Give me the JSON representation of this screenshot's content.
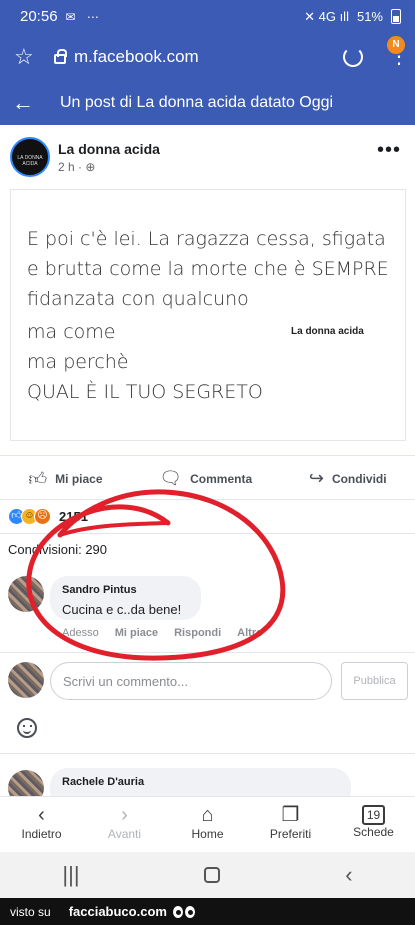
{
  "status": {
    "time": "20:56",
    "left_icons": "✉ ⋯",
    "right_icons": "✕ 4G ıll",
    "battery": "51%"
  },
  "browser": {
    "url": "m.facebook.com",
    "notification_badge": "N"
  },
  "header": {
    "title": "Un post di La donna acida datato Oggi"
  },
  "post": {
    "author": "La donna acida",
    "avatar_text": "LA DONNA ACIDA",
    "meta": "2 h · ⊕",
    "image_lines": [
      "E poi c'è lei. La ragazza cessa, sfigata",
      "e brutta come la morte che è SEMPRE",
      "fidanzata con qualcuno",
      "ma come",
      "ma perchè",
      "QUAL È IL TUO SEGRETO"
    ],
    "image_watermark": "La donna acida",
    "actions": {
      "like": "Mi piace",
      "comment": "Commenta",
      "share": "Condividi"
    },
    "reaction_count": "2151",
    "shares": "Condivisioni: 290"
  },
  "comments": [
    {
      "author": "Sandro Pintus",
      "text": "Cucina e c..da bene!",
      "actions": [
        "Adesso",
        "Mi piace",
        "Rispondi",
        "Altro"
      ]
    },
    {
      "author": "Rachele D'auria",
      "text": ""
    }
  ],
  "composer": {
    "placeholder": "Scrivi un commento...",
    "publish": "Pubblica"
  },
  "bottom_nav": [
    {
      "label": "Indietro",
      "icon": "back-icon"
    },
    {
      "label": "Avanti",
      "icon": "forward-icon"
    },
    {
      "label": "Home",
      "icon": "home-icon"
    },
    {
      "label": "Preferiti",
      "icon": "bookmarks-icon"
    },
    {
      "label": "Schede",
      "icon": "tabs-icon"
    }
  ],
  "tabs_count": "19",
  "footer": {
    "prefix": "visto su",
    "site": "facciabuco.com"
  },
  "colors": {
    "facebook_blue": "#3b5bb5",
    "circle_red": "#e0212b"
  }
}
